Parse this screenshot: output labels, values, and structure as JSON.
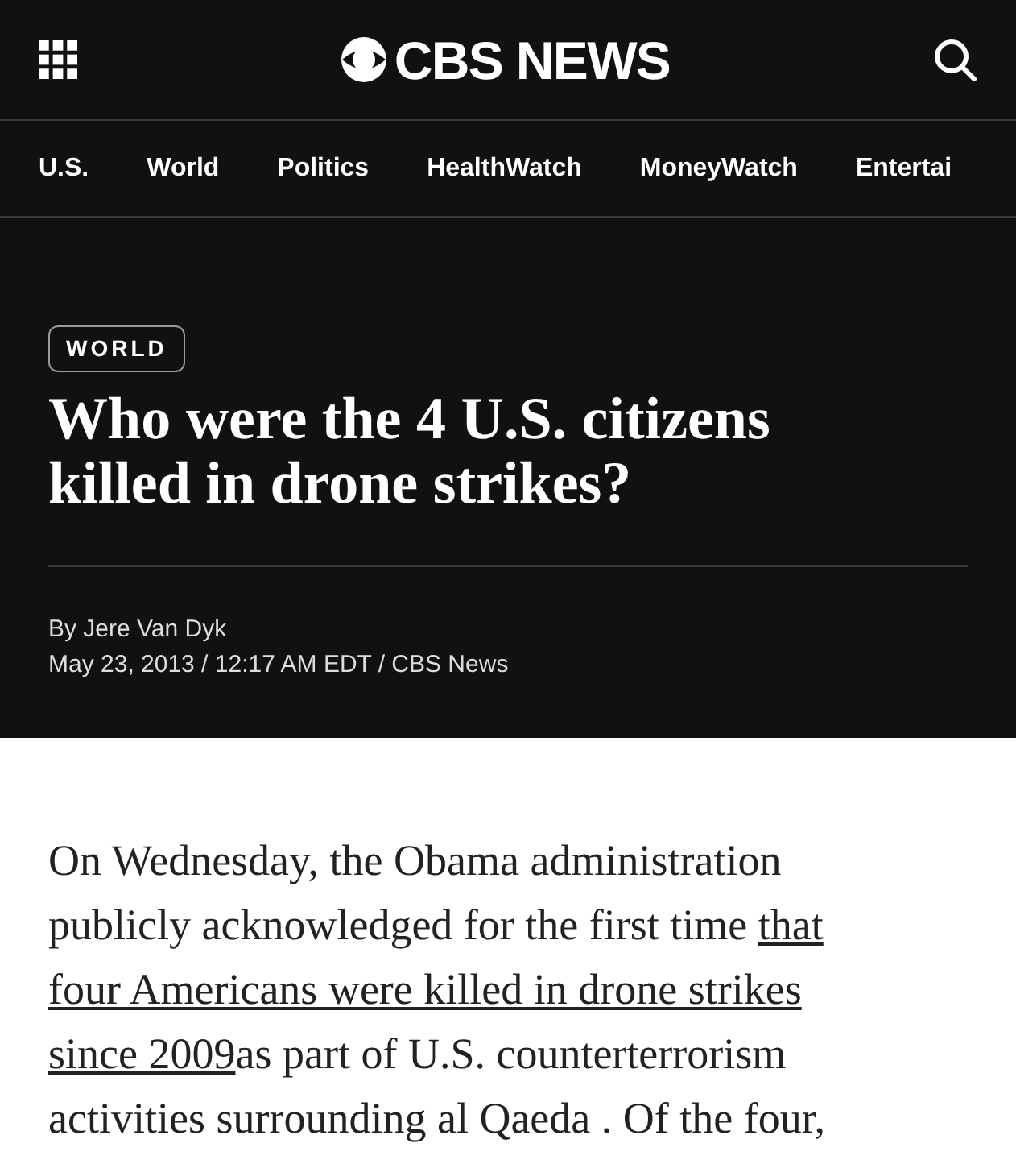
{
  "header": {
    "logo": "CBS NEWS"
  },
  "nav": [
    {
      "label": "U.S."
    },
    {
      "label": "World"
    },
    {
      "label": "Politics"
    },
    {
      "label": "HealthWatch"
    },
    {
      "label": "MoneyWatch"
    },
    {
      "label": "Entertai"
    }
  ],
  "article": {
    "category": "WORLD",
    "headline": "Who were the 4 U.S. citizens killed in drone strikes?",
    "byline": "By Jere Van Dyk",
    "dateline": "May 23, 2013 / 12:17 AM EDT / CBS News",
    "body_lines": [
      {
        "segments": [
          {
            "text": "On Wednesday, the Obama administration",
            "link": false
          }
        ]
      },
      {
        "segments": [
          {
            "text": "publicly acknowledged for the first time ",
            "link": false
          },
          {
            "text": "that",
            "link": true
          }
        ]
      },
      {
        "segments": [
          {
            "text": "four Americans were killed in drone strikes",
            "link": true
          }
        ]
      },
      {
        "segments": [
          {
            "text": "since 2009",
            "link": true
          },
          {
            "text": "as part of U.S. counterterrorism",
            "link": false
          }
        ]
      },
      {
        "segments": [
          {
            "text": "activities surrounding al Qaeda . Of the four,",
            "link": false
          }
        ]
      }
    ]
  }
}
